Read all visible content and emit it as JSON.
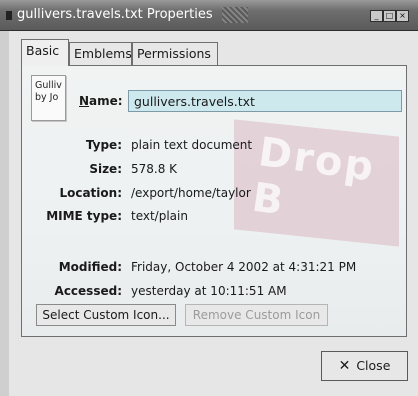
{
  "window": {
    "title": "gullivers.travels.txt Properties",
    "buttons": {
      "minimize": "_",
      "maximize": "□",
      "close": "×"
    }
  },
  "tabs": [
    {
      "label": "Basic",
      "selected": true
    },
    {
      "label": "Emblems"
    },
    {
      "label": "Permissions"
    }
  ],
  "basic": {
    "icon_text": "Gulliv\nby Jo",
    "name_label": "Name:",
    "name_value": "gullivers.travels.txt",
    "fields": {
      "type": {
        "label": "Type:",
        "value": "plain text document"
      },
      "size": {
        "label": "Size:",
        "value": "578.8 K"
      },
      "location": {
        "label": "Location:",
        "value": "/export/home/taylor"
      },
      "mime": {
        "label": "MIME type:",
        "value": "text/plain"
      },
      "modified": {
        "label": "Modified:",
        "value": "Friday, October 4 2002 at 4:31:21 PM"
      },
      "accessed": {
        "label": "Accessed:",
        "value": "yesterday at 10:11:51 AM"
      }
    },
    "watermark_text": "Drop B",
    "buttons": {
      "select_icon": "Select Custom Icon...",
      "remove_icon": "Remove Custom Icon"
    }
  },
  "footer": {
    "close_label": "Close",
    "close_icon": "close-x-icon"
  },
  "colors": {
    "name_field_bg": "#cde9ee",
    "watermark": "#d9b8c2"
  }
}
